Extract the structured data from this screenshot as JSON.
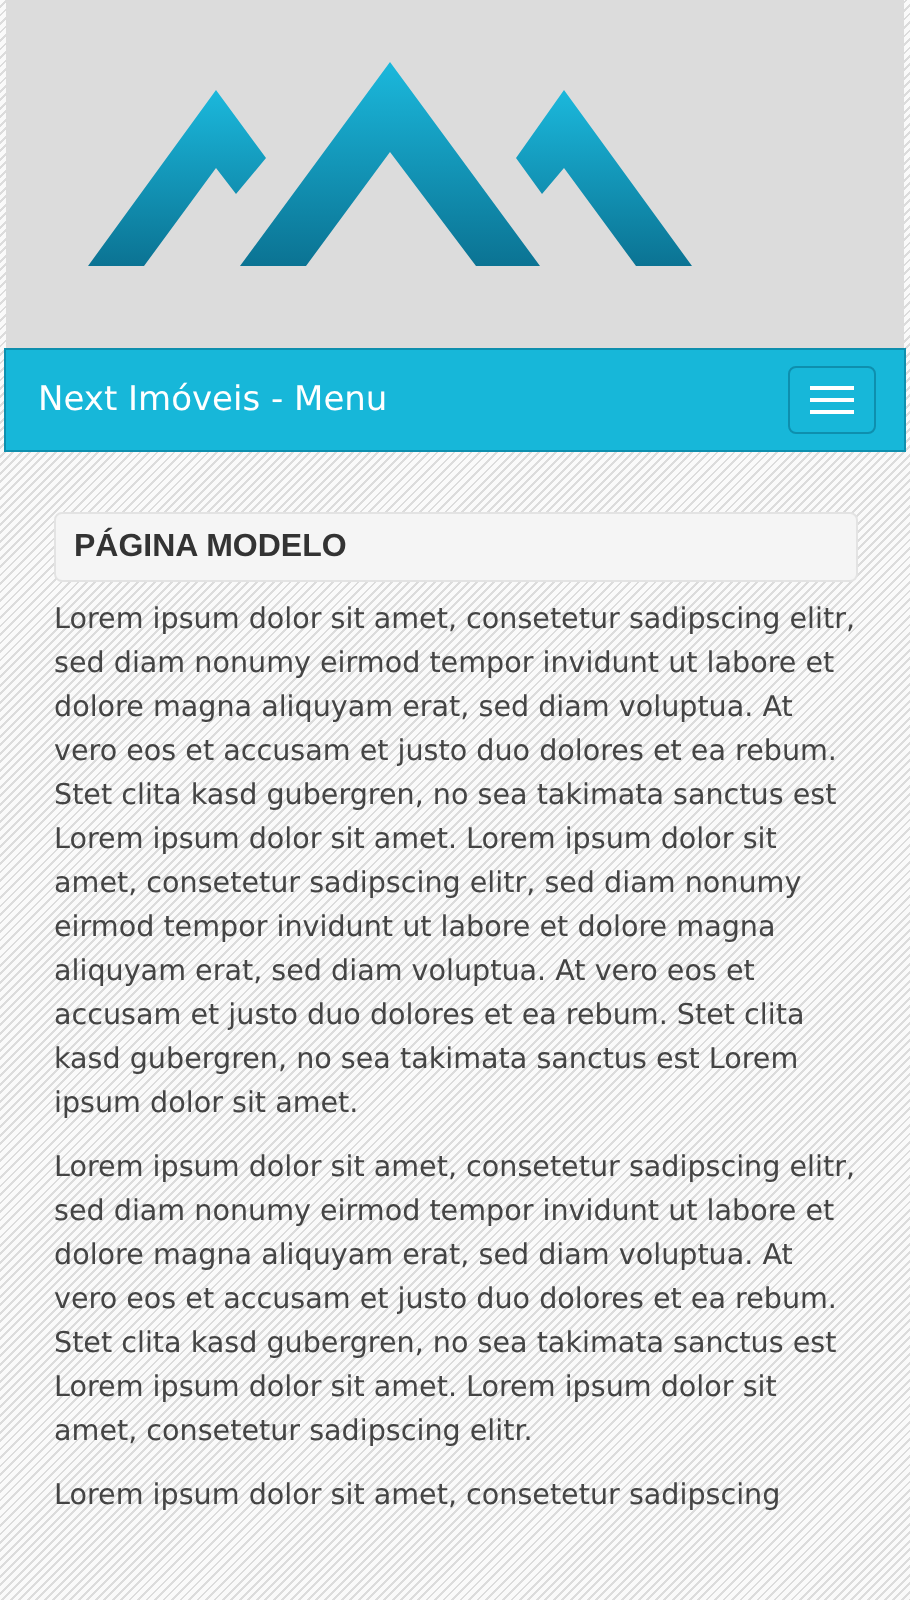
{
  "navbar": {
    "brand": "Next Imóveis - Menu"
  },
  "page": {
    "heading": "PÁGINA MODELO",
    "paragraphs": [
      "Lorem ipsum dolor sit amet, consetetur sadipscing elitr, sed diam nonumy eirmod tempor invidunt ut labore et dolore magna aliquyam erat, sed diam voluptua. At vero eos et accusam et justo duo dolores et ea rebum. Stet clita kasd gubergren, no sea takimata sanctus est Lorem ipsum dolor sit amet. Lorem ipsum dolor sit amet, consetetur sadipscing elitr, sed diam nonumy eirmod tempor invidunt ut labore et dolore magna aliquyam erat, sed diam voluptua. At vero eos et accusam et justo duo dolores et ea rebum. Stet clita kasd gubergren, no sea takimata sanctus est Lorem ipsum dolor sit amet.",
      "Lorem ipsum dolor sit amet, consetetur sadipscing elitr, sed diam nonumy eirmod tempor invidunt ut labore et dolore magna aliquyam erat, sed diam voluptua. At vero eos et accusam et justo duo dolores et ea rebum. Stet clita kasd gubergren, no sea takimata sanctus est Lorem ipsum dolor sit amet. Lorem ipsum dolor sit amet, consetetur sadipscing elitr.",
      "Lorem ipsum dolor sit amet, consetetur sadipscing"
    ]
  }
}
